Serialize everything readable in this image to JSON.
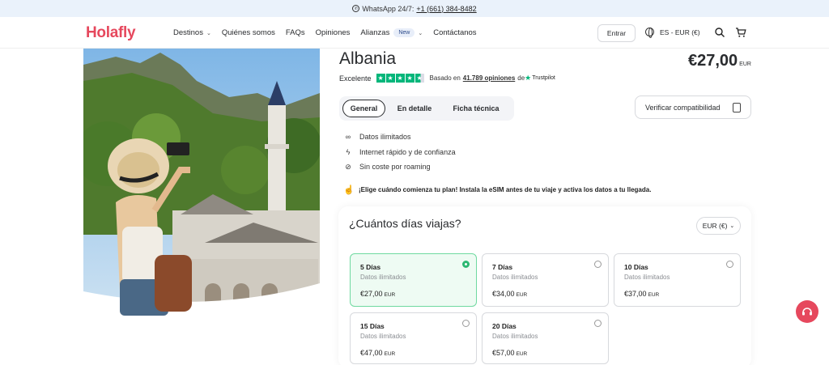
{
  "topbar": {
    "label": "WhatsApp 24/7:",
    "phone": "+1 (661) 384-8482"
  },
  "header": {
    "logo": "Holafly",
    "nav": [
      {
        "label": "Destinos",
        "dropdown": true
      },
      {
        "label": "Quiénes somos"
      },
      {
        "label": "FAQs"
      },
      {
        "label": "Opiniones"
      },
      {
        "label": "Alianzas",
        "badge": "New",
        "dropdown": true
      },
      {
        "label": "Contáctanos"
      }
    ],
    "enter_label": "Entrar",
    "language": "ES - EUR (€)",
    "icons": [
      "globe-icon",
      "search-icon",
      "cart-icon"
    ]
  },
  "product": {
    "title": "Albania",
    "price": "€27,00",
    "price_currency": "EUR",
    "rating_label": "Excelente",
    "stars": 4.5,
    "based_on": "Basado en",
    "reviews": "41.789 opiniones",
    "de": "de",
    "trustpilot": "Trustpilot"
  },
  "tabs": [
    "General",
    "En detalle",
    "Ficha técnica"
  ],
  "verify_label": "Verificar compatibilidad",
  "features": [
    {
      "icon": "infinity-icon",
      "label": "Datos ilimitados"
    },
    {
      "icon": "bolt-icon",
      "label": "Internet rápido y de confianza"
    },
    {
      "icon": "no-roaming-icon",
      "label": "Sin coste por roaming"
    }
  ],
  "note": "¡Elige cuándo comienza tu plan! Instala la eSIM antes de tu viaje y activa los datos a tu llegada.",
  "days_card": {
    "title": "¿Cuántos días viajas?",
    "currency": "EUR (€)",
    "options": [
      {
        "days": "5 Días",
        "data": "Datos ilimitados",
        "price": "€27,00",
        "cur": "EUR",
        "selected": true
      },
      {
        "days": "7 Días",
        "data": "Datos ilimitados",
        "price": "€34,00",
        "cur": "EUR",
        "selected": false
      },
      {
        "days": "10 Días",
        "data": "Datos ilimitados",
        "price": "€37,00",
        "cur": "EUR",
        "selected": false
      },
      {
        "days": "15 Días",
        "data": "Datos ilimitados",
        "price": "€47,00",
        "cur": "EUR",
        "selected": false
      },
      {
        "days": "20 Días",
        "data": "Datos ilimitados",
        "price": "€57,00",
        "cur": "EUR",
        "selected": false
      }
    ]
  },
  "colors": {
    "brand": "#e6485d",
    "trustpilot": "#00b67a",
    "selected": "#2cb872",
    "topbar": "#eaf2fb"
  }
}
